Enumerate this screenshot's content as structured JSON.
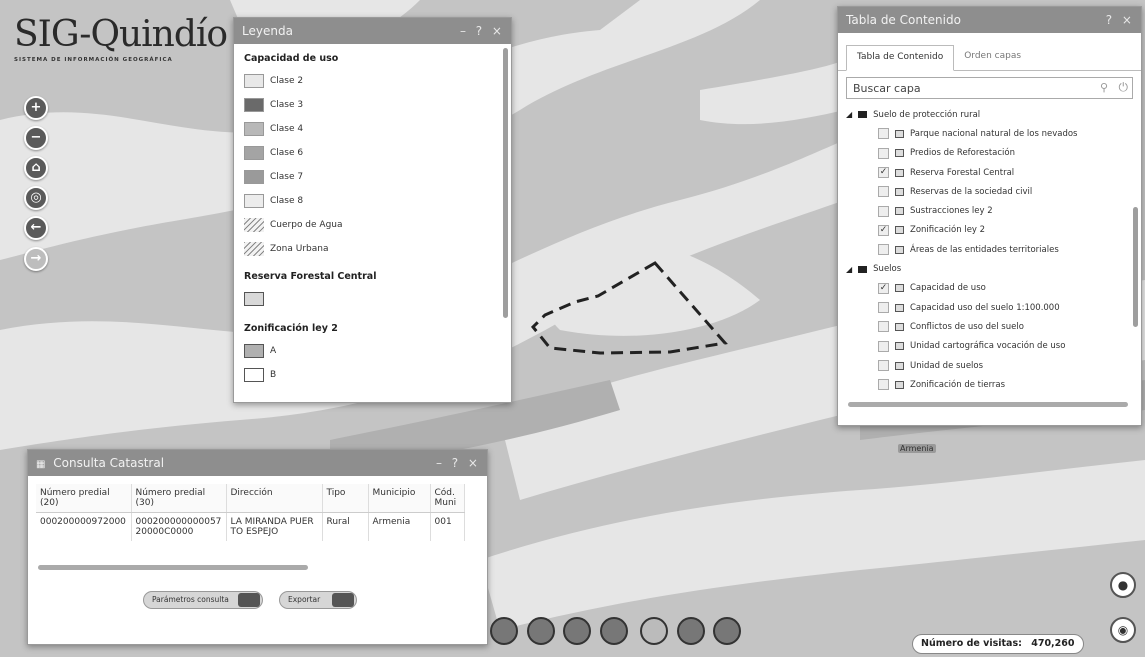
{
  "logo": {
    "title": "SIG-Quindío",
    "subtitle": "SISTEMA DE INFORMACIÓN GEOGRÁFICA"
  },
  "nav": {
    "zoom_in": "+",
    "zoom_out": "−",
    "home": "⌂",
    "locate": "◎",
    "back": "←",
    "forward": "→"
  },
  "legend": {
    "title": "Leyenda",
    "controls": "– ? ×",
    "section1": "Capacidad de uso",
    "items": [
      {
        "label": "Clase 2",
        "color": "#e8e8e8"
      },
      {
        "label": "Clase 3",
        "color": "#6a6a6a"
      },
      {
        "label": "Clase 4",
        "color": "#b8b8b8"
      },
      {
        "label": "Clase 6",
        "color": "#a4a4a4"
      },
      {
        "label": "Clase 7",
        "color": "#9a9a9a"
      },
      {
        "label": "Clase 8",
        "color": "#ececec"
      },
      {
        "label": "Cuerpo de Agua",
        "color": "#f2f2f2"
      },
      {
        "label": "Zona Urbana",
        "color": "#f2f2f2"
      }
    ],
    "section2": "Reserva Forestal Central",
    "section3": "Zonificación ley 2",
    "zon_items": [
      "A",
      "B"
    ]
  },
  "toc": {
    "title": "Tabla de Contenido",
    "controls": "? ×",
    "tab1": "Tabla de Contenido",
    "tab2": "Orden capas",
    "search_placeholder": "Buscar capa",
    "rows": [
      {
        "type": "group",
        "label": "Suelo de protección rural"
      },
      {
        "type": "layer",
        "label": "Parque nacional natural de los nevados",
        "checked": false
      },
      {
        "type": "layer",
        "label": "Predios de Reforestación",
        "checked": false
      },
      {
        "type": "layer",
        "label": "Reserva Forestal Central",
        "checked": true
      },
      {
        "type": "layer",
        "label": "Reservas de la sociedad civil",
        "checked": false
      },
      {
        "type": "layer",
        "label": "Sustracciones ley 2",
        "checked": false
      },
      {
        "type": "layer",
        "label": "Zonificación ley 2",
        "checked": true
      },
      {
        "type": "layer",
        "label": "Áreas de las entidades territoriales",
        "checked": false
      },
      {
        "type": "group",
        "label": "Suelos"
      },
      {
        "type": "layer",
        "label": "Capacidad de uso",
        "checked": true
      },
      {
        "type": "layer",
        "label": "Capacidad uso del suelo 1:100.000",
        "checked": false
      },
      {
        "type": "layer",
        "label": "Conflictos de uso del suelo",
        "checked": false
      },
      {
        "type": "layer",
        "label": "Unidad cartográfica vocación de uso",
        "checked": false
      },
      {
        "type": "layer",
        "label": "Unidad de suelos",
        "checked": false
      },
      {
        "type": "layer",
        "label": "Zonificación de tierras",
        "checked": false
      }
    ]
  },
  "consulta": {
    "title": "Consulta Catastral",
    "controls": "– ? ×",
    "headers": [
      "Número predial (20)",
      "Número predial (30)",
      "Dirección",
      "Tipo",
      "Municipio",
      "Cód. Muni"
    ],
    "row": [
      "000200000972000",
      "00020000000005720000C0000",
      "LA MIRANDA PUERTO ESPEJO",
      "Rural",
      "Armenia",
      "001"
    ],
    "btn_params": "Parámetros consulta",
    "btn_export": "Exportar"
  },
  "map": {
    "city": "Armenia"
  },
  "visits": {
    "label": "Número de visitas:",
    "value": "470,260"
  }
}
